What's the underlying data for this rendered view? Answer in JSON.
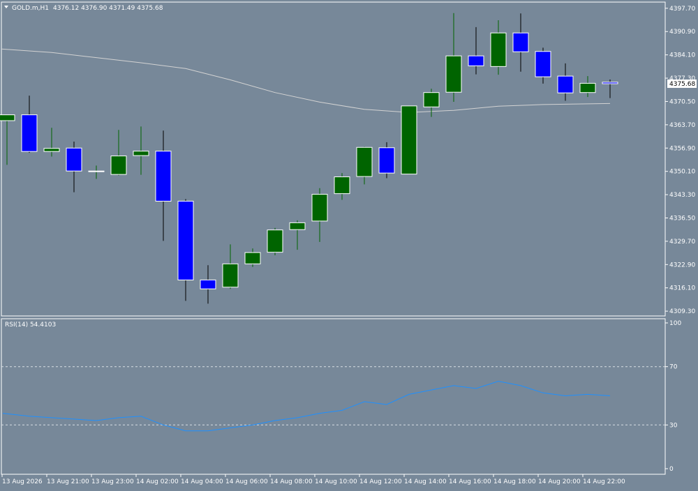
{
  "symbol_label": "GOLD.m,H1",
  "ohlc_readout": "4376.12 4376.90 4371.49 4375.68",
  "last_price_label": "4375.68",
  "rsi_label": "RSI(14) 54.4103",
  "colors": {
    "background": "#778899",
    "bull": "#006400",
    "bear": "#0000ff",
    "wick_bull": "#006400",
    "wick_bear": "#000000",
    "candle_border": "#ffffff",
    "ma_line": "#d3d3d3",
    "rsi_line": "#1e90ff",
    "grid_text": "#ffffff"
  },
  "chart_data": [
    {
      "type": "candlestick",
      "title": "GOLD.m,H1",
      "price_ticks": [
        "4397.70",
        "4390.90",
        "4384.10",
        "4377.30",
        "4370.50",
        "4363.70",
        "4356.90",
        "4350.10",
        "4343.30",
        "4336.50",
        "4329.70",
        "4322.90",
        "4316.10",
        "4309.30"
      ],
      "time_labels": [
        "13 Aug 2026",
        "13 Aug 21:00",
        "13 Aug 23:00",
        "14 Aug 02:00",
        "14 Aug 04:00",
        "14 Aug 06:00",
        "14 Aug 08:00",
        "14 Aug 10:00",
        "14 Aug 12:00",
        "14 Aug 14:00",
        "14 Aug 16:00",
        "14 Aug 18:00",
        "14 Aug 20:00",
        "14 Aug 22:00"
      ],
      "ylim": [
        4307.9,
        4399.5
      ],
      "candles": [
        {
          "open": 4364.9,
          "high": 4366.0,
          "low": 4352.0,
          "close": 4366.6
        },
        {
          "open": 4366.6,
          "high": 4372.2,
          "low": 4355.5,
          "close": 4355.9
        },
        {
          "open": 4355.9,
          "high": 4362.8,
          "low": 4354.4,
          "close": 4356.8
        },
        {
          "open": 4356.9,
          "high": 4358.8,
          "low": 4344.0,
          "close": 4350.2
        },
        {
          "open": 4350.2,
          "high": 4351.8,
          "low": 4347.9,
          "close": 4350.2
        },
        {
          "open": 4349.2,
          "high": 4362.2,
          "low": 4348.9,
          "close": 4354.6
        },
        {
          "open": 4354.7,
          "high": 4363.2,
          "low": 4349.1,
          "close": 4356.0
        },
        {
          "open": 4356.0,
          "high": 4362.0,
          "low": 4329.8,
          "close": 4341.4
        },
        {
          "open": 4341.4,
          "high": 4342.0,
          "low": 4312.3,
          "close": 4318.4
        },
        {
          "open": 4318.4,
          "high": 4322.7,
          "low": 4311.5,
          "close": 4315.8
        },
        {
          "open": 4316.3,
          "high": 4328.8,
          "low": 4315.8,
          "close": 4323.1
        },
        {
          "open": 4323.1,
          "high": 4327.6,
          "low": 4322.2,
          "close": 4326.4
        },
        {
          "open": 4326.5,
          "high": 4333.6,
          "low": 4325.6,
          "close": 4333.0
        },
        {
          "open": 4333.1,
          "high": 4335.8,
          "low": 4327.2,
          "close": 4335.1
        },
        {
          "open": 4335.6,
          "high": 4345.2,
          "low": 4329.5,
          "close": 4343.4
        },
        {
          "open": 4343.6,
          "high": 4349.6,
          "low": 4341.8,
          "close": 4348.5
        },
        {
          "open": 4348.6,
          "high": 4357.3,
          "low": 4346.3,
          "close": 4357.1
        },
        {
          "open": 4357.0,
          "high": 4358.6,
          "low": 4348.1,
          "close": 4349.6
        },
        {
          "open": 4349.3,
          "high": 4369.2,
          "low": 4349.2,
          "close": 4369.2
        },
        {
          "open": 4368.9,
          "high": 4374.2,
          "low": 4366.0,
          "close": 4373.1
        },
        {
          "open": 4373.2,
          "high": 4396.3,
          "low": 4370.4,
          "close": 4383.8
        },
        {
          "open": 4383.8,
          "high": 4392.2,
          "low": 4378.4,
          "close": 4380.9
        },
        {
          "open": 4380.7,
          "high": 4394.2,
          "low": 4378.3,
          "close": 4390.5
        },
        {
          "open": 4390.5,
          "high": 4396.2,
          "low": 4379.2,
          "close": 4385.0
        },
        {
          "open": 4385.1,
          "high": 4386.2,
          "low": 4375.7,
          "close": 4377.7
        },
        {
          "open": 4377.9,
          "high": 4381.6,
          "low": 4370.7,
          "close": 4373.0
        },
        {
          "open": 4373.1,
          "high": 4377.9,
          "low": 4371.8,
          "close": 4375.8
        },
        {
          "open": 4376.12,
          "high": 4376.9,
          "low": 4371.49,
          "close": 4375.68
        }
      ],
      "moving_average": [
        {
          "i": 0,
          "v": 4385.8
        },
        {
          "i": 2,
          "v": 4384.8
        },
        {
          "i": 4,
          "v": 4383.3
        },
        {
          "i": 6,
          "v": 4381.8
        },
        {
          "i": 8,
          "v": 4380.1
        },
        {
          "i": 10,
          "v": 4376.8
        },
        {
          "i": 12,
          "v": 4373.1
        },
        {
          "i": 14,
          "v": 4370.3
        },
        {
          "i": 16,
          "v": 4368.2
        },
        {
          "i": 18,
          "v": 4367.3
        },
        {
          "i": 20,
          "v": 4367.9
        },
        {
          "i": 22,
          "v": 4369.1
        },
        {
          "i": 24,
          "v": 4369.6
        },
        {
          "i": 27,
          "v": 4369.9
        }
      ]
    },
    {
      "type": "line",
      "title": "RSI(14) 54.4103",
      "y_ticks": [
        "100",
        "70",
        "30",
        "0"
      ],
      "levels": [
        70,
        30
      ],
      "ylim": [
        0,
        100
      ],
      "series": [
        {
          "values": [
            [
              0,
              38
            ],
            [
              1,
              36
            ],
            [
              2,
              35
            ],
            [
              3,
              34
            ],
            [
              4,
              33
            ],
            [
              5,
              35
            ],
            [
              6,
              36
            ],
            [
              7,
              30
            ],
            [
              8,
              26
            ],
            [
              9,
              26
            ],
            [
              10,
              28
            ],
            [
              11,
              30
            ],
            [
              12,
              33
            ],
            [
              13,
              35
            ],
            [
              14,
              38
            ],
            [
              15,
              40
            ],
            [
              16,
              46
            ],
            [
              17,
              44
            ],
            [
              18,
              51
            ],
            [
              19,
              54
            ],
            [
              20,
              57
            ],
            [
              21,
              55
            ],
            [
              22,
              60
            ],
            [
              23,
              57
            ],
            [
              24,
              52
            ],
            [
              25,
              50
            ],
            [
              26,
              51
            ],
            [
              27,
              50
            ]
          ]
        }
      ]
    }
  ]
}
